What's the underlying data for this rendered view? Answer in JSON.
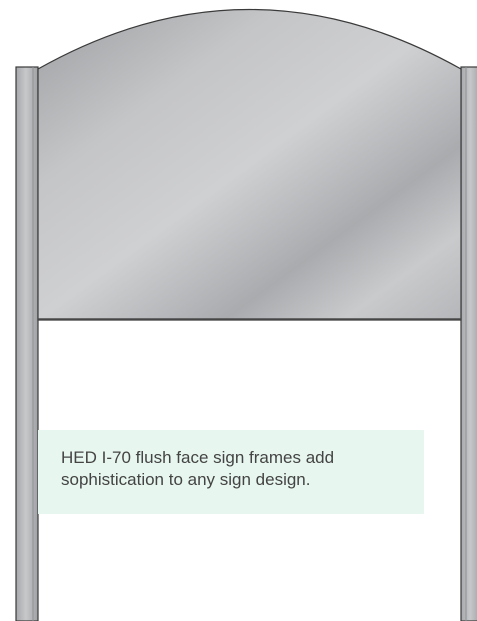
{
  "caption": {
    "text": "HED I-70 flush face sign frames add sophistication to any sign design."
  },
  "colors": {
    "caption_background": "#e7f6ef",
    "caption_text": "#444444",
    "post_fill": "#b9babc",
    "panel_light": "#c9cacc",
    "panel_dark": "#9c9ea1"
  }
}
